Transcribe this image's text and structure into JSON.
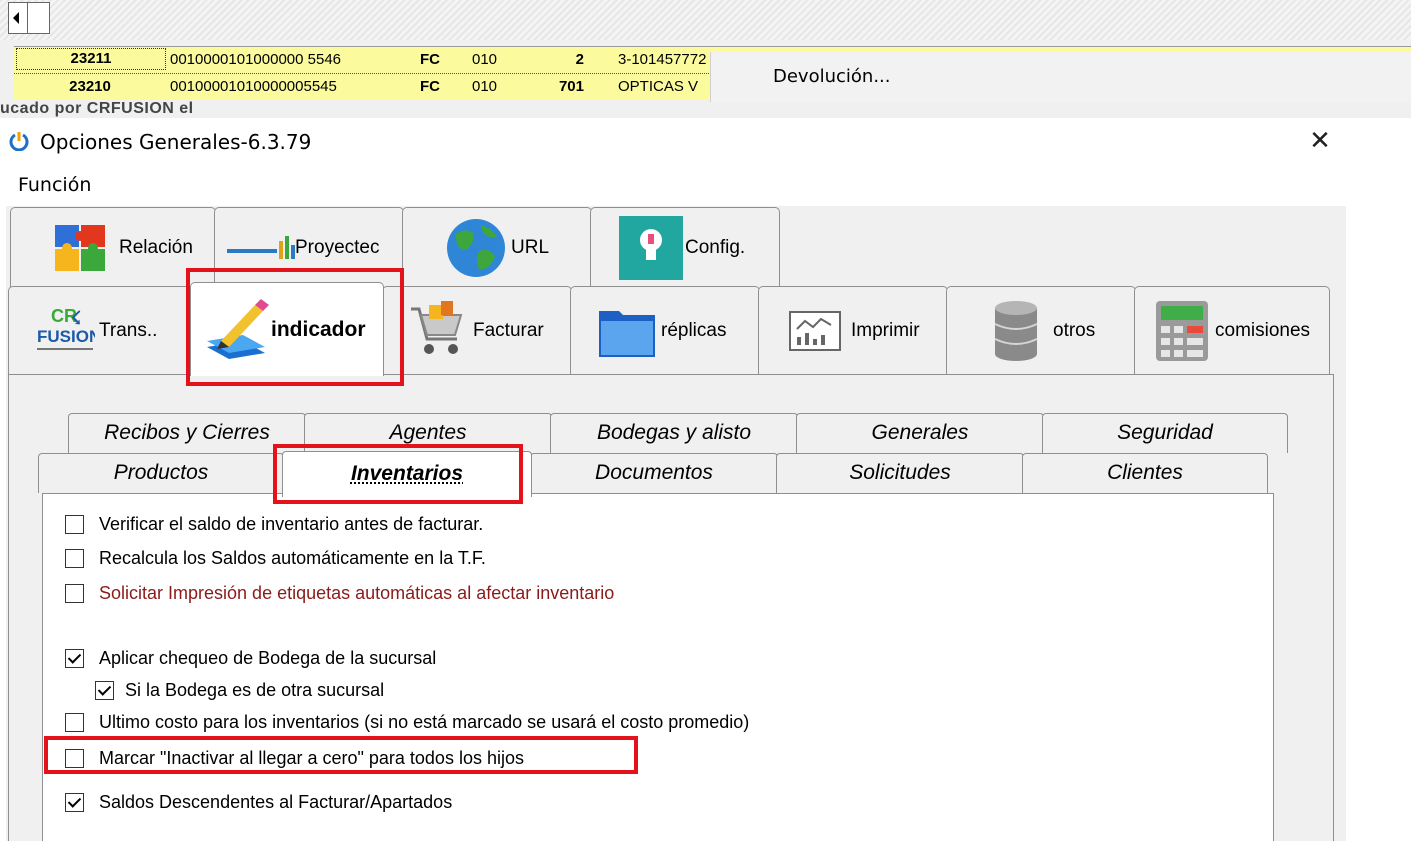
{
  "background_grid": {
    "rows": [
      {
        "id": "23211",
        "number": "0010000101000000 5546",
        "type": "FC",
        "code": "010",
        "qty": "2",
        "client": "3-101457772"
      },
      {
        "id": "23210",
        "number": "00100001010000005545",
        "type": "FC",
        "code": "010",
        "qty": "701",
        "client": "OPTICAS V"
      }
    ],
    "overlap_text": "ucado por CRFUSION el",
    "context_menu_item": "Devolución..."
  },
  "dialog": {
    "title": "Opciones Generales-6.3.79",
    "close_symbol": "✕",
    "menu": [
      "Función"
    ]
  },
  "outer_tabs_row1": [
    {
      "label": "Relación",
      "icon": "puzzle-icon"
    },
    {
      "label": "Proyectec",
      "icon": "proyectec-logo-icon"
    },
    {
      "label": "URL",
      "icon": "globe-icon"
    },
    {
      "label": "Config.",
      "icon": "lightbulb-icon"
    }
  ],
  "outer_tabs_row2": [
    {
      "label": "Trans..",
      "icon": "crfusion-logo-icon"
    },
    {
      "label": "indicador",
      "icon": "pencil-icon",
      "selected": true
    },
    {
      "label": "Facturar",
      "icon": "cart-icon"
    },
    {
      "label": "réplicas",
      "icon": "folder-icon"
    },
    {
      "label": "Imprimir",
      "icon": "report-icon"
    },
    {
      "label": "otros",
      "icon": "database-icon"
    },
    {
      "label": "comisiones",
      "icon": "calculator-icon"
    }
  ],
  "inner_tabs_row1": [
    "Recibos y Cierres",
    "Agentes",
    "Bodegas y alisto",
    "Generales",
    "Seguridad"
  ],
  "inner_tabs_row2": [
    {
      "label": "Productos"
    },
    {
      "label": "Inventarios",
      "selected": true
    },
    {
      "label": "Documentos"
    },
    {
      "label": "Solicitudes"
    },
    {
      "label": "Clientes"
    }
  ],
  "options": [
    {
      "label": "Verificar el saldo de inventario antes de facturar.",
      "checked": false
    },
    {
      "label": "Recalcula los Saldos automáticamente en la T.F.",
      "checked": false
    },
    {
      "label": "Solicitar Impresión de etiquetas automáticas al afectar inventario",
      "checked": false,
      "color": "#8b1a1a"
    },
    {
      "label": "Aplicar chequeo de Bodega de la sucursal",
      "checked": true
    },
    {
      "label": "Si la Bodega es de otra sucursal",
      "checked": true
    },
    {
      "label": "Ultimo costo para los inventarios (si no está marcado se usará el costo promedio)",
      "checked": false
    },
    {
      "label": "Marcar \"Inactivar al llegar a cero\" para todos los hijos",
      "checked": false
    },
    {
      "label": "Saldos Descendentes al Facturar/Apartados",
      "checked": true
    }
  ],
  "colors": {
    "highlight": "#e3121b",
    "grid_row": "#fbfb9e",
    "panel": "#f0f0f0"
  }
}
